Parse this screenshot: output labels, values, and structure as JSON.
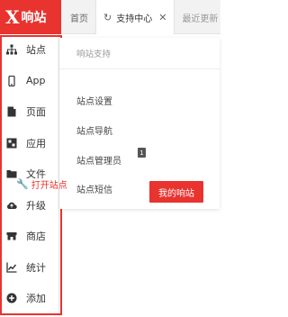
{
  "brand": {
    "logo_letter": "X",
    "name": "响站"
  },
  "tabs": [
    {
      "label": "首页"
    },
    {
      "label": "支持中心",
      "active": true
    },
    {
      "label": "最近更新"
    }
  ],
  "sidebar": {
    "items": [
      {
        "label": "站点",
        "icon": "sitemap-icon"
      },
      {
        "label": "App",
        "icon": "mobile-icon"
      },
      {
        "label": "页面",
        "icon": "page-icon"
      },
      {
        "label": "应用",
        "icon": "apps-icon"
      },
      {
        "label": "文件",
        "icon": "folder-icon"
      },
      {
        "label": "升级",
        "icon": "cloud-upload-icon"
      },
      {
        "label": "商店",
        "icon": "store-icon"
      },
      {
        "label": "统计",
        "icon": "chart-icon"
      },
      {
        "label": "添加",
        "icon": "plus-circle-icon"
      }
    ]
  },
  "panel": {
    "title": "响站支持",
    "items": [
      "站点设置",
      "站点导航",
      "站点管理员",
      "站点短信"
    ],
    "badge": "1",
    "open_site": "打开站点",
    "my_site_button": "我的响站"
  },
  "colors": {
    "accent": "#e8332f"
  }
}
